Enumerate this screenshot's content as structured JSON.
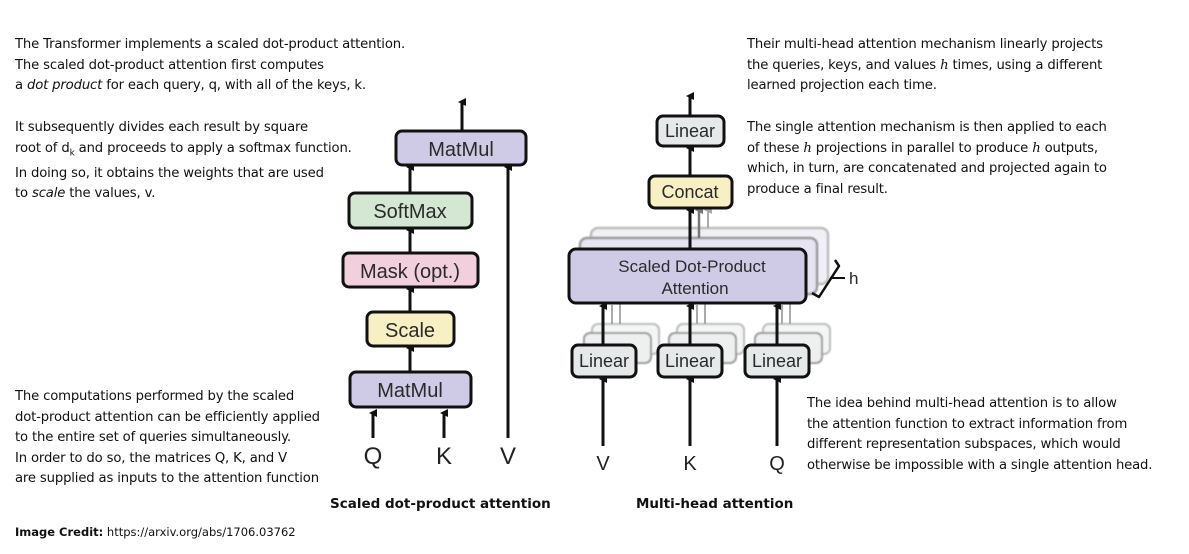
{
  "notes": {
    "intro": {
      "lines": [
        "The Transformer implements a scaled dot-product attention.",
        "The scaled dot-product attention first computes"
      ],
      "line3_prefix": "a ",
      "line3_italic": "dot product",
      "line3_suffix": " for each query, q, with all of the keys, k."
    },
    "scaling": {
      "line1": "It subsequently divides each result by square",
      "line2_prefix": "root of d",
      "line2_sub": "k",
      "line2_suffix": " and proceeds to apply a softmax function.",
      "line3": "In doing so, it obtains the weights that are used",
      "line4_prefix": "to ",
      "line4_italic": "scale",
      "line4_suffix": " the values, v."
    },
    "matrix": {
      "lines": [
        "The computations performed by the scaled",
        "dot-product attention can be efficiently applied",
        "to the entire set of queries simultaneously.",
        "In order to do so, the matrices Q, K, and V",
        "are supplied as inputs to the attention function"
      ]
    },
    "multihead_intro": {
      "line1": "Their multi-head attention mechanism linearly projects",
      "line2_prefix": "the queries, keys, and values ",
      "line2_math": "h",
      "line2_suffix": " times, using a different",
      "line3": "learned projection each time."
    },
    "multihead_parallel": {
      "line1": "The single attention mechanism is then applied to each",
      "line2_prefix": "of these ",
      "line2_math1": "h",
      "line2_mid": " projections in parallel to produce ",
      "line2_math2": "h",
      "line2_suffix": " outputs,",
      "line3": "which, in turn, are concatenated and projected again to",
      "line4": "produce a final result."
    },
    "multihead_idea": {
      "lines": [
        "The idea behind multi-head attention is to allow",
        "the attention function to extract information from",
        "different representation subspaces, which would",
        "otherwise be impossible with a single attention head."
      ]
    }
  },
  "scaled_dot_product": {
    "caption": "Scaled dot-product attention",
    "blocks": {
      "matmul_top": "MatMul",
      "softmax": "SoftMax",
      "mask": "Mask (opt.)",
      "scale": "Scale",
      "matmul_bottom": "MatMul"
    },
    "inputs": {
      "q": "Q",
      "k": "K",
      "v": "V"
    },
    "colors": {
      "matmul": "#cfcbe6",
      "softmax": "#d4e7d2",
      "mask": "#f1cfdc",
      "scale": "#f7f0c4"
    }
  },
  "multi_head": {
    "caption": "Multi-head attention",
    "blocks": {
      "linear_top": "Linear",
      "concat": "Concat",
      "attention_line1": "Scaled Dot-Product",
      "attention_line2": "Attention",
      "linear_v": "Linear",
      "linear_k": "Linear",
      "linear_q": "Linear"
    },
    "heads_label": "h",
    "inputs": {
      "v": "V",
      "k": "K",
      "q": "Q"
    },
    "colors": {
      "linear": "#e6e9ea",
      "concat": "#f7f0c4",
      "attention": "#cfcbe6"
    }
  },
  "credit": {
    "label": "Image Credit:",
    "url": "https://arxiv.org/abs/1706.03762"
  }
}
